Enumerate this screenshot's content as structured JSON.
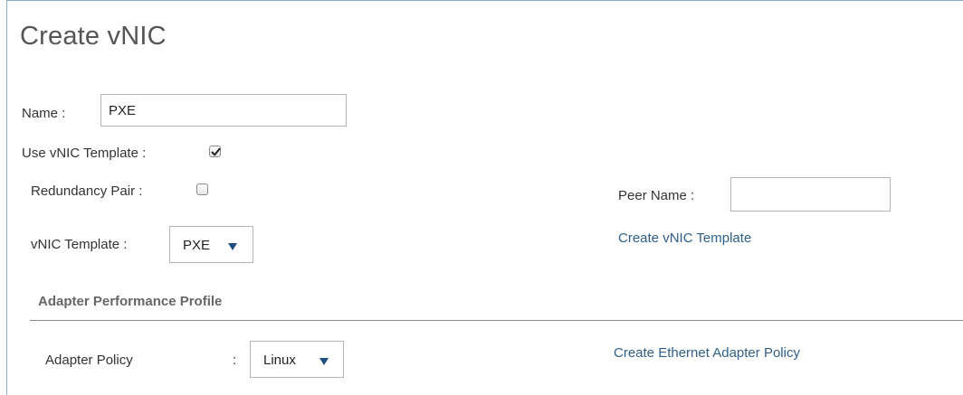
{
  "dialog": {
    "title": "Create vNIC"
  },
  "form": {
    "name": {
      "label": "Name :",
      "value": "PXE"
    },
    "use_template": {
      "label": "Use vNIC Template :",
      "checked": true
    },
    "redundancy_pair": {
      "label": "Redundancy Pair :",
      "checked": false
    },
    "peer_name": {
      "label": "Peer Name :",
      "value": ""
    },
    "vnic_template": {
      "label": "vNIC Template :",
      "selected": "PXE",
      "arrow_icon": "dropdown-arrow-icon"
    },
    "create_vnic_template_link": "Create vNIC Template"
  },
  "adapter_section": {
    "title": "Adapter Performance Profile",
    "adapter_policy": {
      "label": "Adapter Policy",
      "separator": ":",
      "selected": "Linux"
    },
    "create_adapter_policy_link": "Create Ethernet Adapter Policy"
  },
  "colors": {
    "border": "#8fa9c9",
    "link": "#2e5f8a",
    "arrow": "#1d4e80"
  }
}
